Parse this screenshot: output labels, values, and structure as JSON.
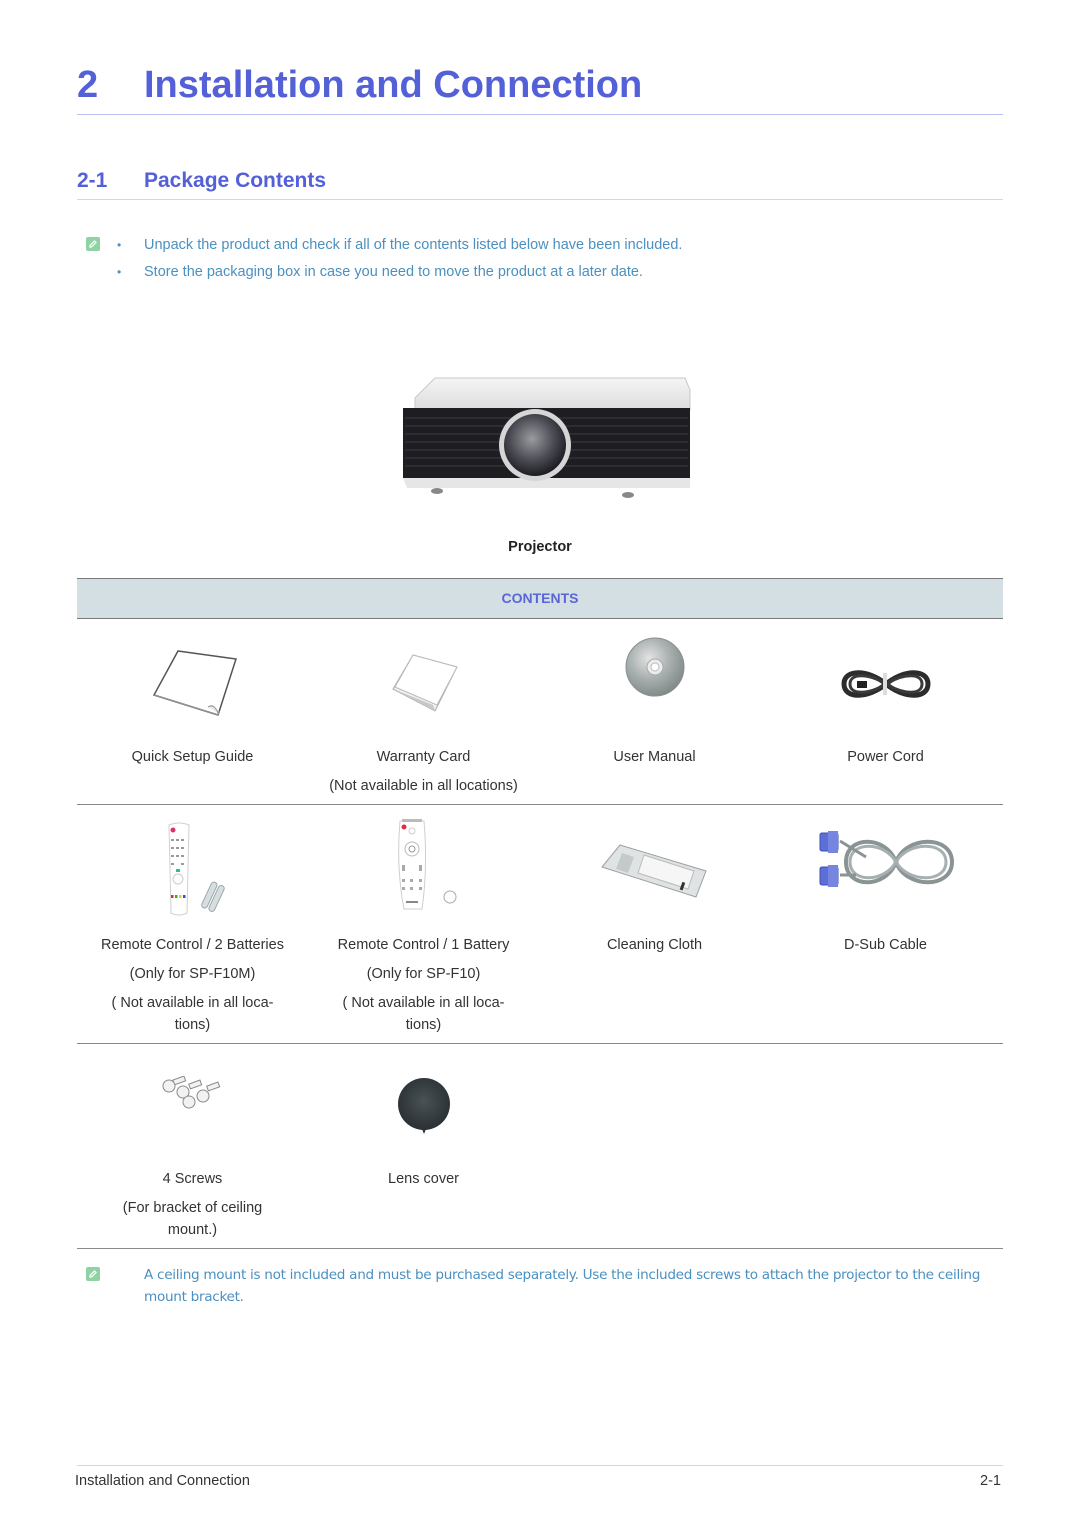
{
  "chapter": {
    "number": "2",
    "title": "Installation and Connection"
  },
  "section": {
    "number": "2-1",
    "title": "Package Contents"
  },
  "intro_note": {
    "icon": "note-pencil-icon",
    "bullets": [
      "Unpack the product and check if all of the contents listed below have been included.",
      "Store the packaging box in case you need to move the product at a later date."
    ]
  },
  "main_product": {
    "icon": "projector-image",
    "caption": "Projector"
  },
  "contents_table": {
    "header": "CONTENTS",
    "rows": [
      [
        {
          "icon": "quick-setup-guide-image",
          "lines": [
            "Quick Setup Guide"
          ]
        },
        {
          "icon": "warranty-card-image",
          "lines": [
            "Warranty Card",
            "(Not available in all locations)"
          ]
        },
        {
          "icon": "user-manual-cd-image",
          "lines": [
            "User Manual"
          ]
        },
        {
          "icon": "power-cord-image",
          "lines": [
            "Power Cord"
          ]
        }
      ],
      [
        {
          "icon": "remote-control-2-batteries-image",
          "lines": [
            "Remote Control / 2 Batteries",
            "(Only for SP-F10M)",
            "( Not available in all loca-",
            "tions)"
          ]
        },
        {
          "icon": "remote-control-1-battery-image",
          "lines": [
            "Remote Control / 1 Battery",
            "(Only for SP-F10)",
            "( Not available in all loca-",
            "tions)"
          ]
        },
        {
          "icon": "cleaning-cloth-image",
          "lines": [
            "Cleaning Cloth"
          ]
        },
        {
          "icon": "d-sub-cable-image",
          "lines": [
            "D-Sub Cable"
          ]
        }
      ],
      [
        {
          "icon": "screws-image",
          "lines": [
            "4 Screws",
            "(For bracket of ceiling",
            "mount.)"
          ]
        },
        {
          "icon": "lens-cover-image",
          "lines": [
            "Lens cover"
          ]
        }
      ]
    ]
  },
  "footnote": {
    "icon": "note-pencil-icon",
    "text": "A ceiling mount is not included and must be purchased separately. Use the included screws to attach the projector to the ceiling mount bracket."
  },
  "footer": {
    "left": "Installation and Connection",
    "right": "2-1"
  },
  "colors": {
    "heading": "#5460d8",
    "note_text": "#4a90c0",
    "table_header_bg": "#d4dfe3",
    "note_icon": "#8fd3a5"
  }
}
